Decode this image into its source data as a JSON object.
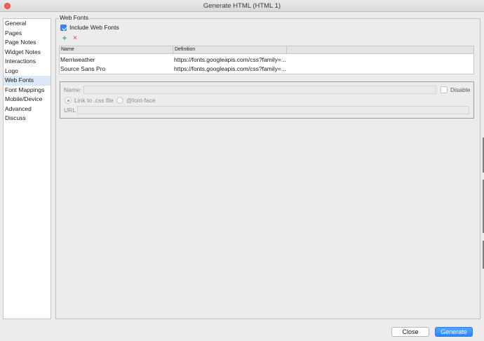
{
  "window": {
    "title": "Generate HTML (HTML 1)"
  },
  "sidebar": {
    "items": [
      {
        "label": "General",
        "selected": false
      },
      {
        "label": "Pages",
        "selected": false
      },
      {
        "label": "Page Notes",
        "selected": false
      },
      {
        "label": "Widget Notes",
        "selected": false
      },
      {
        "label": "Interactions",
        "selected": false
      },
      {
        "label": "Logo",
        "selected": false
      },
      {
        "label": "Web Fonts",
        "selected": true
      },
      {
        "label": "Font Mappings",
        "selected": false
      },
      {
        "label": "Mobile/Device",
        "selected": false
      },
      {
        "label": "Advanced",
        "selected": false
      },
      {
        "label": "Discuss",
        "selected": false
      }
    ]
  },
  "webfonts": {
    "group_title": "Web Fonts",
    "include_label": "Include Web Fonts",
    "include_checked": true,
    "add_icon": "plus-icon",
    "remove_icon": "x-icon",
    "table": {
      "columns": [
        "Name",
        "Definition"
      ],
      "rows": [
        {
          "name": "Merriweather",
          "definition": "https://fonts.googleapis.com/css?family=..."
        },
        {
          "name": "Source Sans Pro",
          "definition": "https://fonts.googleapis.com/css?family=..."
        }
      ]
    },
    "detail": {
      "name_label": "Name:",
      "name_value": "",
      "disable_label": "Disable",
      "link_css_label": "Link to .css file",
      "font_face_label": "@font-face",
      "url_label": "URL",
      "url_value": ""
    }
  },
  "footer": {
    "close_label": "Close",
    "generate_label": "Generate"
  },
  "colors": {
    "accent": "#3b88f5",
    "selection": "#dbe9f7",
    "add_icon": "#4caf50",
    "remove_icon": "#e57373"
  }
}
